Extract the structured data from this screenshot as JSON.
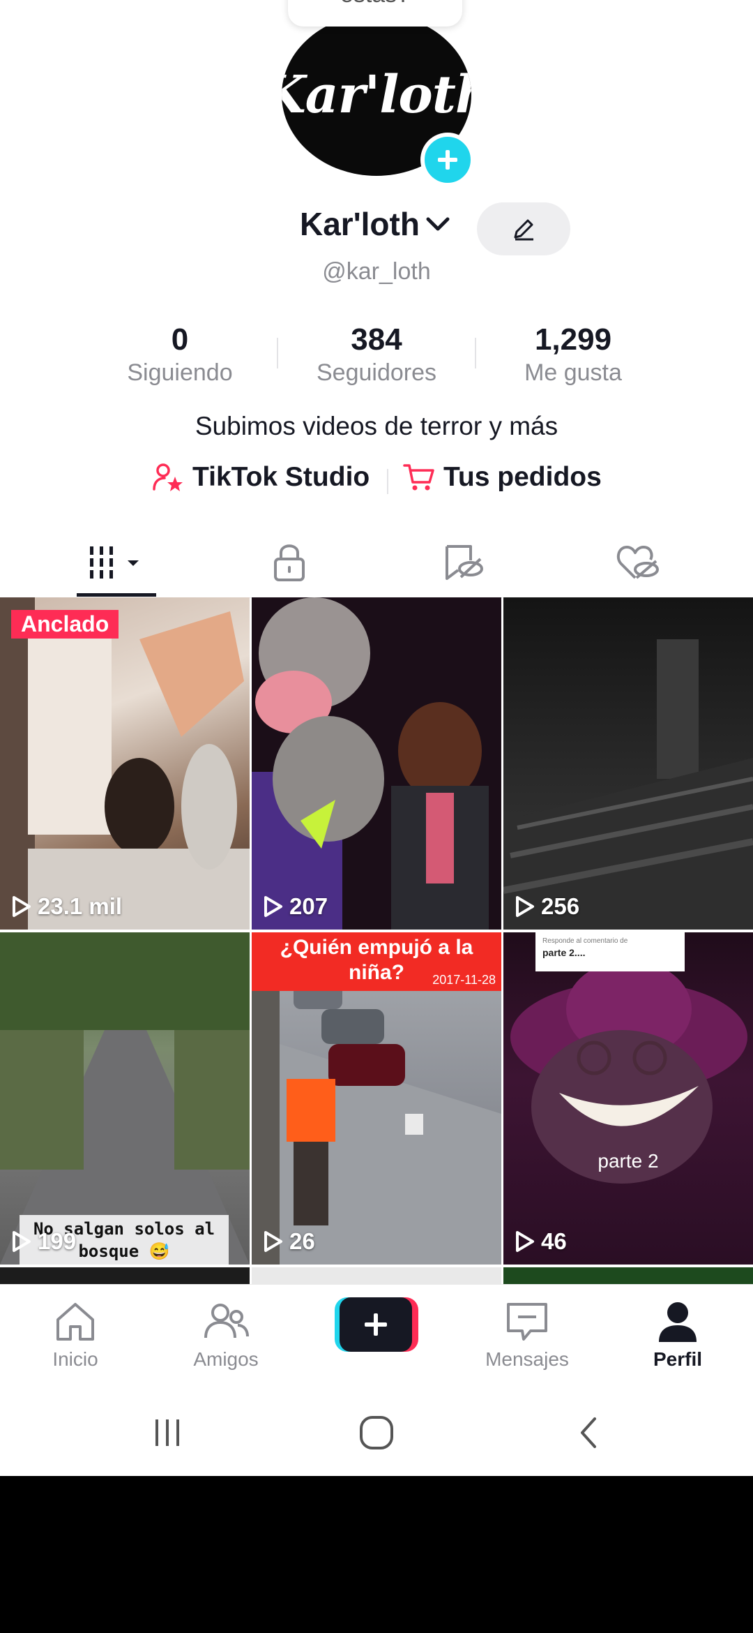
{
  "profile": {
    "bubble_text": "estás?",
    "avatar_text": "Kar'loth",
    "display_name": "Kar'loth",
    "handle": "@kar_loth",
    "bio": "Subimos videos de terror y más"
  },
  "stats": [
    {
      "value": "0",
      "label": "Siguiendo"
    },
    {
      "value": "384",
      "label": "Seguidores"
    },
    {
      "value": "1,299",
      "label": "Me gusta"
    }
  ],
  "links": {
    "studio": "TikTok Studio",
    "orders": "Tus pedidos"
  },
  "tabs": [
    {
      "icon": "grid-icon",
      "active": true
    },
    {
      "icon": "lock-icon"
    },
    {
      "icon": "repost-hidden-icon"
    },
    {
      "icon": "liked-hidden-icon"
    }
  ],
  "videos": [
    {
      "views": "23.1 mil",
      "pinned_label": "Anclado"
    },
    {
      "views": "207"
    },
    {
      "views": "256"
    },
    {
      "views": "199",
      "caption": "No salgan solos al bosque 😅"
    },
    {
      "views": "26",
      "caption": "¿Quién empujó a la niña?",
      "date": "2017-11-28"
    },
    {
      "views": "46",
      "caption": "parte 2",
      "reply_label": "Responde al comentario de",
      "reply_text": "parte 2...."
    }
  ],
  "bottom_nav": [
    {
      "label": "Inicio"
    },
    {
      "label": "Amigos"
    },
    {
      "label": "Mensajes"
    },
    {
      "label": "Perfil",
      "active": true
    }
  ],
  "colors": {
    "accent": "#fe2c55",
    "cyan": "#20d5ec",
    "text": "#161823",
    "muted": "#8a8b91"
  }
}
